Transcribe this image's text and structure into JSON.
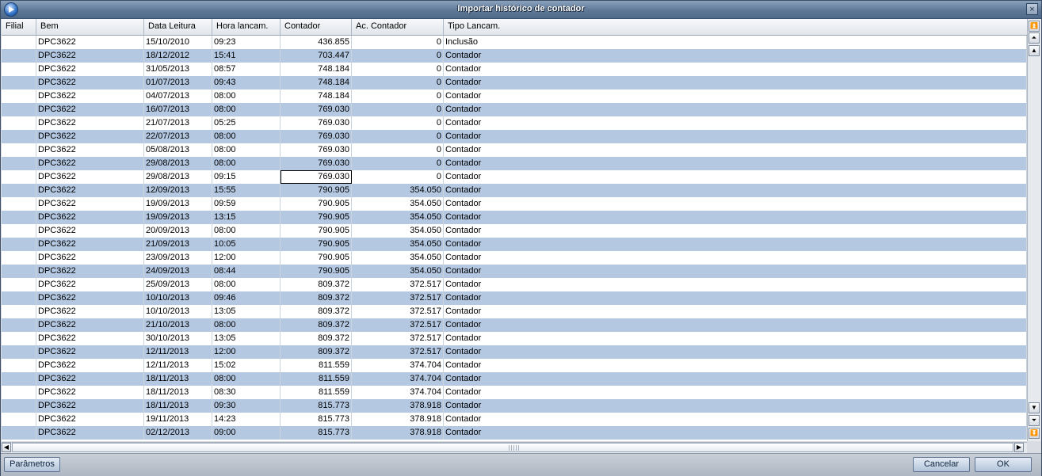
{
  "window": {
    "title": "Importar histórico de contador",
    "close_label": "×"
  },
  "grid": {
    "columns": [
      "Filial",
      "Bem",
      "Data Leitura",
      "Hora lancam.",
      "Contador",
      "Ac. Contador",
      "Tipo Lancam."
    ],
    "rows": [
      [
        "",
        "DPC3622",
        "15/10/2010",
        "09:23",
        "436.855",
        "0",
        "Inclusão"
      ],
      [
        "",
        "DPC3622",
        "18/12/2012",
        "15:41",
        "703.447",
        "0",
        "Contador"
      ],
      [
        "",
        "DPC3622",
        "31/05/2013",
        "08:57",
        "748.184",
        "0",
        "Contador"
      ],
      [
        "",
        "DPC3622",
        "01/07/2013",
        "09:43",
        "748.184",
        "0",
        "Contador"
      ],
      [
        "",
        "DPC3622",
        "04/07/2013",
        "08:00",
        "748.184",
        "0",
        "Contador"
      ],
      [
        "",
        "DPC3622",
        "16/07/2013",
        "08:00",
        "769.030",
        "0",
        "Contador"
      ],
      [
        "",
        "DPC3622",
        "21/07/2013",
        "05:25",
        "769.030",
        "0",
        "Contador"
      ],
      [
        "",
        "DPC3622",
        "22/07/2013",
        "08:00",
        "769.030",
        "0",
        "Contador"
      ],
      [
        "",
        "DPC3622",
        "05/08/2013",
        "08:00",
        "769.030",
        "0",
        "Contador"
      ],
      [
        "",
        "DPC3622",
        "29/08/2013",
        "08:00",
        "769.030",
        "0",
        "Contador"
      ],
      [
        "",
        "DPC3622",
        "29/08/2013",
        "09:15",
        "769.030",
        "0",
        "Contador"
      ],
      [
        "",
        "DPC3622",
        "12/09/2013",
        "15:55",
        "790.905",
        "354.050",
        "Contador"
      ],
      [
        "",
        "DPC3622",
        "19/09/2013",
        "09:59",
        "790.905",
        "354.050",
        "Contador"
      ],
      [
        "",
        "DPC3622",
        "19/09/2013",
        "13:15",
        "790.905",
        "354.050",
        "Contador"
      ],
      [
        "",
        "DPC3622",
        "20/09/2013",
        "08:00",
        "790.905",
        "354.050",
        "Contador"
      ],
      [
        "",
        "DPC3622",
        "21/09/2013",
        "10:05",
        "790.905",
        "354.050",
        "Contador"
      ],
      [
        "",
        "DPC3622",
        "23/09/2013",
        "12:00",
        "790.905",
        "354.050",
        "Contador"
      ],
      [
        "",
        "DPC3622",
        "24/09/2013",
        "08:44",
        "790.905",
        "354.050",
        "Contador"
      ],
      [
        "",
        "DPC3622",
        "25/09/2013",
        "08:00",
        "809.372",
        "372.517",
        "Contador"
      ],
      [
        "",
        "DPC3622",
        "10/10/2013",
        "09:46",
        "809.372",
        "372.517",
        "Contador"
      ],
      [
        "",
        "DPC3622",
        "10/10/2013",
        "13:05",
        "809.372",
        "372.517",
        "Contador"
      ],
      [
        "",
        "DPC3622",
        "21/10/2013",
        "08:00",
        "809.372",
        "372.517",
        "Contador"
      ],
      [
        "",
        "DPC3622",
        "30/10/2013",
        "13:05",
        "809.372",
        "372.517",
        "Contador"
      ],
      [
        "",
        "DPC3622",
        "12/11/2013",
        "12:00",
        "809.372",
        "372.517",
        "Contador"
      ],
      [
        "",
        "DPC3622",
        "12/11/2013",
        "15:02",
        "811.559",
        "374.704",
        "Contador"
      ],
      [
        "",
        "DPC3622",
        "18/11/2013",
        "08:00",
        "811.559",
        "374.704",
        "Contador"
      ],
      [
        "",
        "DPC3622",
        "18/11/2013",
        "08:30",
        "811.559",
        "374.704",
        "Contador"
      ],
      [
        "",
        "DPC3622",
        "18/11/2013",
        "09:30",
        "815.773",
        "378.918",
        "Contador"
      ],
      [
        "",
        "DPC3622",
        "19/11/2013",
        "14:23",
        "815.773",
        "378.918",
        "Contador"
      ],
      [
        "",
        "DPC3622",
        "02/12/2013",
        "09:00",
        "815.773",
        "378.918",
        "Contador"
      ]
    ],
    "selected": {
      "row": 10,
      "col": 4
    }
  },
  "scroll": {
    "top_icon": "scroll-top-icon",
    "page_up_icon": "scroll-page-up-icon",
    "up_icon": "scroll-up-icon",
    "down_icon": "scroll-down-icon",
    "page_down_icon": "scroll-page-down-icon",
    "bottom_icon": "scroll-bottom-icon"
  },
  "footer": {
    "params_label": "Parâmetros",
    "cancel_label": "Cancelar",
    "ok_label": "OK"
  }
}
